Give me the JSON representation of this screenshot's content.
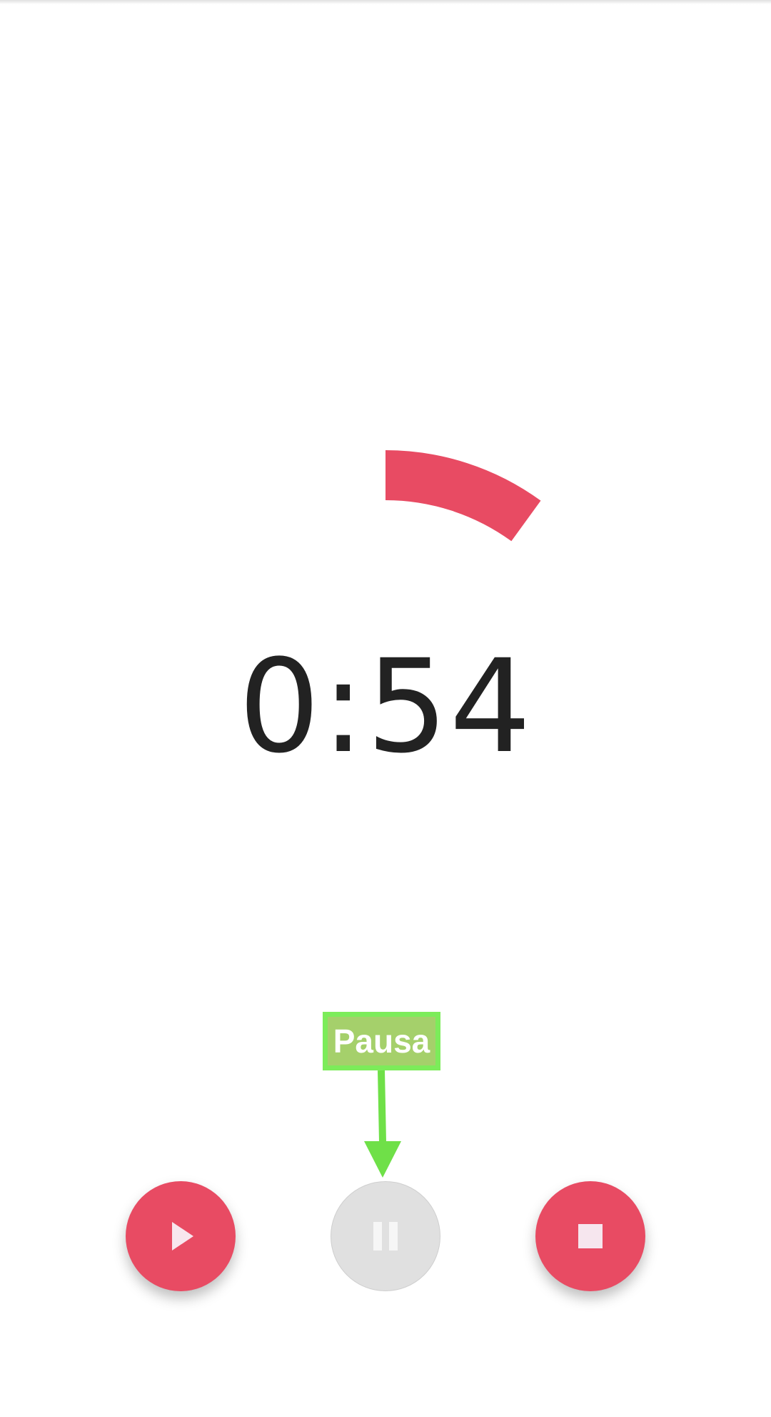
{
  "timer": {
    "display": "0:54",
    "progress_fraction": 0.1
  },
  "tooltip": {
    "label": "Pausa"
  },
  "controls": {
    "play": {
      "icon": "play-icon",
      "enabled": true
    },
    "pause": {
      "icon": "pause-icon",
      "enabled": false
    },
    "stop": {
      "icon": "stop-icon",
      "enabled": true
    }
  },
  "colors": {
    "accent": "#e84b63",
    "disabled": "#e0e0e0",
    "text": "#222222",
    "tooltip_bg": "#7cec5a",
    "tooltip_inner": "#a5d06b"
  }
}
